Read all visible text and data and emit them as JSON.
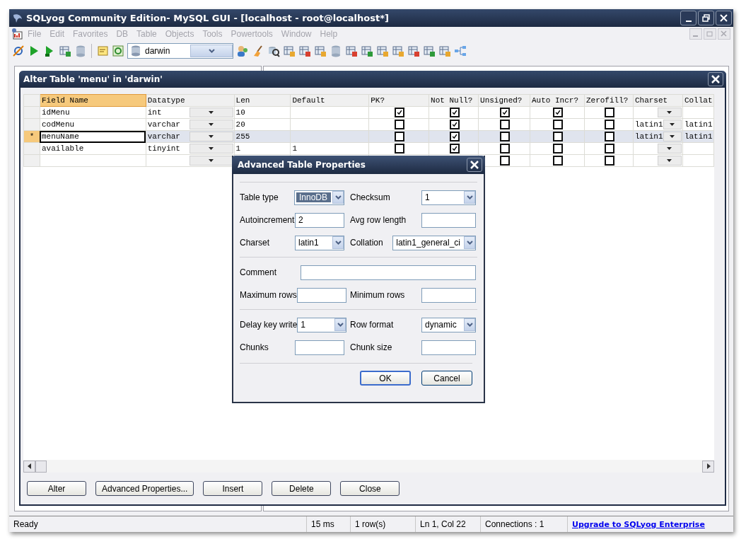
{
  "window": {
    "title": "SQLyog Community Edition- MySQL GUI - [localhost - root@localhost*]"
  },
  "menu": [
    {
      "label": "File",
      "disabled": true
    },
    {
      "label": "Edit",
      "disabled": true
    },
    {
      "label": "Favorites",
      "disabled": true
    },
    {
      "label": "DB",
      "disabled": true
    },
    {
      "label": "Table",
      "disabled": true
    },
    {
      "label": "Objects",
      "disabled": true
    },
    {
      "label": "Tools",
      "disabled": true
    },
    {
      "label": "Powertools",
      "disabled": true
    },
    {
      "label": "Window",
      "disabled": true
    },
    {
      "label": "Help",
      "disabled": true
    }
  ],
  "toolbar": {
    "database": "darwin"
  },
  "alter_dialog": {
    "title": "Alter Table 'menu' in 'darwin'",
    "columns": [
      {
        "label": "Field Name",
        "kind": "text",
        "selected": true
      },
      {
        "label": "Datatype",
        "kind": "combo",
        "selected": false
      },
      {
        "label": "Len",
        "kind": "text",
        "selected": false
      },
      {
        "label": "Default",
        "kind": "text",
        "selected": false
      },
      {
        "label": "PK?",
        "kind": "check",
        "selected": false
      },
      {
        "label": "Not Null?",
        "kind": "check",
        "selected": false
      },
      {
        "label": "Unsigned?",
        "kind": "check",
        "selected": false
      },
      {
        "label": "Auto Incr?",
        "kind": "check",
        "selected": false
      },
      {
        "label": "Zerofill?",
        "kind": "check",
        "selected": false
      },
      {
        "label": "Charset",
        "kind": "combo",
        "selected": false
      },
      {
        "label": "Collat",
        "kind": "text",
        "selected": false
      }
    ],
    "rows": [
      {
        "selected": false,
        "field": "idMenu",
        "datatype": "int",
        "len": "10",
        "pk": true,
        "not_null": true,
        "unsigned": true,
        "auto_increment": true,
        "zerofill": false
      },
      {
        "selected": false,
        "field": "codMenu",
        "datatype": "varchar",
        "len": "20",
        "pk": false,
        "not_null": true,
        "unsigned": false,
        "auto_increment": false,
        "zerofill": false,
        "charset": "latin1",
        "collation": "latin1"
      },
      {
        "selected": true,
        "marker": "*",
        "field": "menuName",
        "datatype": "varchar",
        "len": "255",
        "pk": false,
        "not_null": true,
        "unsigned": false,
        "auto_increment": false,
        "zerofill": false,
        "charset": "latin1",
        "collation": "latin1"
      },
      {
        "selected": false,
        "field": "available",
        "datatype": "tinyint",
        "len": "1",
        "default": "1",
        "pk": false,
        "not_null": true,
        "unsigned": false,
        "auto_increment": false,
        "zerofill": false
      },
      {
        "selected": false,
        "unsigned": false,
        "auto_increment": false,
        "zerofill": false
      }
    ],
    "buttons": [
      "Alter",
      "Advanced Properties...",
      "Insert",
      "Delete",
      "Close"
    ]
  },
  "advanced_dialog": {
    "title": "Advanced Table Properties",
    "sections": [
      [
        {
          "label": "Table type",
          "kind": "select",
          "value": "InnoDB",
          "focused": true
        },
        {
          "label": "Checksum",
          "kind": "select",
          "value": "1",
          "focused": false
        },
        {
          "label": "Autoincrement",
          "kind": "input",
          "value": "2"
        },
        {
          "label": "Avg row length",
          "kind": "input"
        },
        {
          "label": "Charset",
          "kind": "select",
          "value": "latin1",
          "focused": false
        },
        {
          "label": "Collation",
          "kind": "select",
          "value": "latin1_general_ci",
          "focused": false
        }
      ],
      [
        {
          "label": "Comment",
          "kind": "wide-input"
        },
        {
          "label": "Maximum rows",
          "kind": "input"
        },
        {
          "label": "Minimum rows",
          "kind": "input"
        }
      ],
      [
        {
          "label": "Delay key write",
          "kind": "select",
          "value": "1",
          "focused": false
        },
        {
          "label": "Row format",
          "kind": "select",
          "value": "dynamic",
          "focused": false
        },
        {
          "label": "Chunks",
          "kind": "input"
        },
        {
          "label": "Chunk size",
          "kind": "input"
        }
      ]
    ],
    "buttons": [
      {
        "label": "OK",
        "default": true
      },
      {
        "label": "Cancel",
        "default": false
      }
    ]
  },
  "status_bar": {
    "status": "Ready",
    "time": "15 ms",
    "rows": "1 row(s)",
    "position": "Ln 1, Col 22",
    "connections": "Connections : 1",
    "link": "Upgrade to SQLyog Enterprise"
  }
}
